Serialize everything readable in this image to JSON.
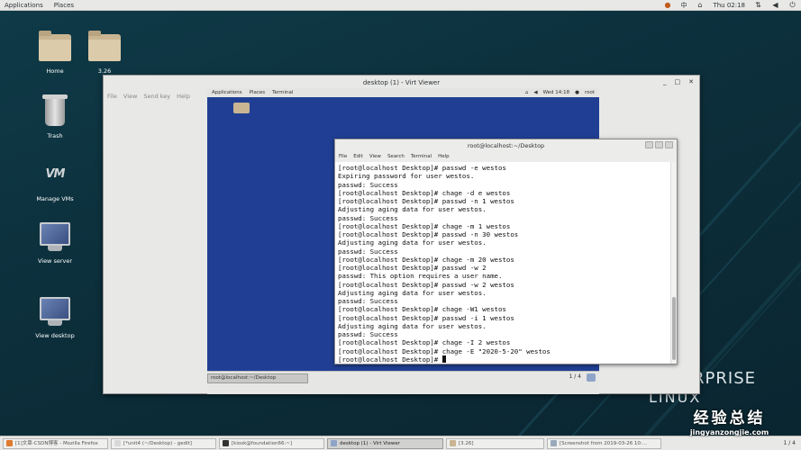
{
  "topbar": {
    "applications": "Applications",
    "places": "Places",
    "lang": "中",
    "clock": "Thu 02:18"
  },
  "desktop_icons": [
    {
      "label": "Home"
    },
    {
      "label": "3.26"
    },
    {
      "label": "Trash"
    },
    {
      "label": "Manage VMs"
    },
    {
      "label": "View server"
    },
    {
      "label": "View desktop"
    }
  ],
  "desktop_brand": {
    "line1": "RPRISE",
    "line2": "LINUX"
  },
  "virt_viewer": {
    "title": "desktop (1) - Virt Viewer",
    "menu": [
      "File",
      "View",
      "Send key",
      "Help"
    ],
    "guest": {
      "topbar": {
        "applications": "Applications",
        "places": "Places",
        "app": "Terminal",
        "clock": "Wed 14:18",
        "user": "root"
      },
      "terminal": {
        "title": "root@localhost:~/Desktop",
        "menu": [
          "File",
          "Edit",
          "View",
          "Search",
          "Terminal",
          "Help"
        ],
        "lines": [
          "[root@localhost Desktop]# passwd -e westos",
          "Expiring password for user westos.",
          "passwd: Success",
          "[root@localhost Desktop]# chage -d e westos",
          "[root@localhost Desktop]# passwd -n 1 westos",
          "Adjusting aging data for user westos.",
          "passwd: Success",
          "[root@localhost Desktop]# chage -m 1 westos",
          "[root@localhost Desktop]# passwd -n 30 westos",
          "Adjusting aging data for user westos.",
          "passwd: Success",
          "[root@localhost Desktop]# chage -m 20 westos",
          "[root@localhost Desktop]# passwd -w 2",
          "passwd: This option requires a user name.",
          "[root@localhost Desktop]# passwd -w 2 westos",
          "Adjusting aging data for user westos.",
          "passwd: Success",
          "[root@localhost Desktop]# chage -W1 westos",
          "[root@localhost Desktop]# passwd -i 1 westos",
          "Adjusting aging data for user westos.",
          "passwd: Success",
          "[root@localhost Desktop]# chage -I 2 westos",
          "[root@localhost Desktop]# chage -E \"2020-5-20\" westos"
        ],
        "prompt": "[root@localhost Desktop]# "
      },
      "taskbar": {
        "item": "root@localhost:~/Desktop",
        "page": "1 / 4"
      }
    }
  },
  "taskbar": {
    "items": [
      {
        "label": "[1]文章-CSDN博客 - Mozilla Firefox",
        "active": false
      },
      {
        "label": "[*unit4 (~/Desktop) - gedit]",
        "active": false
      },
      {
        "label": "[kiosk@foundation66:~]",
        "active": false
      },
      {
        "label": "desktop (1) - Virt Viewer",
        "active": true
      },
      {
        "label": "[3.26]",
        "active": false
      },
      {
        "label": "[Screenshot from 2019-03-26 10:...",
        "active": false
      }
    ],
    "page": "1 / 4"
  },
  "watermark": {
    "big": "经验总结",
    "small": "jingyanzongjie.com"
  }
}
